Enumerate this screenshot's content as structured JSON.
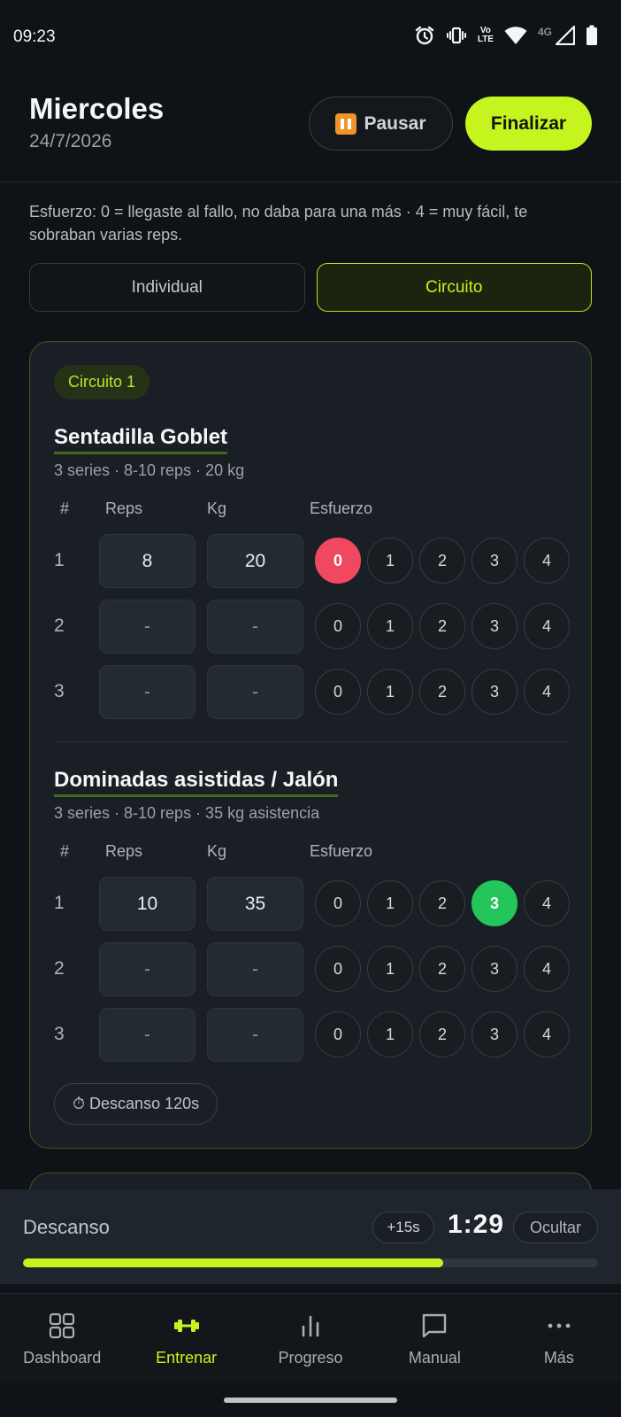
{
  "status_bar": {
    "time": "09:23",
    "volte_label_top": "Vo",
    "volte_label_bottom": "LTE",
    "network_label": "4G",
    "icons": [
      "alarm-icon",
      "vibrate-icon",
      "volte-icon",
      "wifi-icon",
      "signal-icon",
      "battery-icon"
    ]
  },
  "header": {
    "title": "Miercoles",
    "date": "24/7/2026",
    "pause_label": "Pausar",
    "finish_label": "Finalizar"
  },
  "hint": "Esfuerzo: 0 = llegaste al fallo, no daba para una más · 4 = muy fácil, te sobraban varias reps.",
  "mode_toggle": {
    "options": [
      "Individual",
      "Circuito"
    ],
    "selected": "Circuito"
  },
  "circuit": {
    "badge": "Circuito 1",
    "columns": {
      "set": "#",
      "reps": "Reps",
      "kg": "Kg",
      "effort": "Esfuerzo"
    },
    "effort_options": [
      "0",
      "1",
      "2",
      "3",
      "4"
    ],
    "exercises": [
      {
        "name": "Sentadilla Goblet",
        "meta": "3 series · 8-10 reps · 20 kg",
        "sets": [
          {
            "num": "1",
            "reps": "8",
            "kg": "20",
            "effort": "0"
          },
          {
            "num": "2",
            "reps": "-",
            "kg": "-",
            "effort": null
          },
          {
            "num": "3",
            "reps": "-",
            "kg": "-",
            "effort": null
          }
        ]
      },
      {
        "name": "Dominadas asistidas / Jalón",
        "meta": "3 series · 8-10 reps · 35 kg asistencia",
        "sets": [
          {
            "num": "1",
            "reps": "10",
            "kg": "35",
            "effort": "3"
          },
          {
            "num": "2",
            "reps": "-",
            "kg": "-",
            "effort": null
          },
          {
            "num": "3",
            "reps": "-",
            "kg": "-",
            "effort": null
          }
        ]
      }
    ],
    "rest_chip": "⏱ Descanso 120s"
  },
  "rest_timer": {
    "label": "Descanso",
    "add_label": "+15s",
    "time": "1:29",
    "hide_label": "Ocultar",
    "progress": 0.73
  },
  "nav": {
    "items": [
      {
        "label": "Dashboard",
        "icon": "dashboard-icon"
      },
      {
        "label": "Entrenar",
        "icon": "dumbbell-icon"
      },
      {
        "label": "Progreso",
        "icon": "bar-chart-icon"
      },
      {
        "label": "Manual",
        "icon": "chat-square-icon"
      },
      {
        "label": "Más",
        "icon": "more-icon"
      }
    ],
    "active": "Entrenar"
  },
  "colors": {
    "accent": "#c6f41e",
    "effort_fail": "#ef4860",
    "effort_good": "#24c55a",
    "background": "#0f1216",
    "card": "#1a1f25"
  }
}
